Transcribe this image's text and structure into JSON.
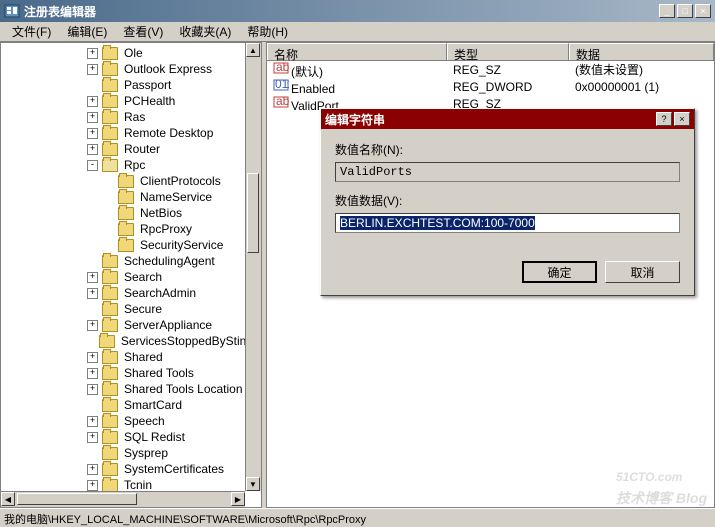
{
  "window": {
    "title": "注册表编辑器",
    "min": "_",
    "max": "□",
    "close": "×"
  },
  "menu": {
    "file": "文件(F)",
    "edit": "编辑(E)",
    "view": "查看(V)",
    "fav": "收藏夹(A)",
    "help": "帮助(H)"
  },
  "tree": {
    "items": [
      {
        "indent": 84,
        "exp": "+",
        "label": "Ole"
      },
      {
        "indent": 84,
        "exp": "+",
        "label": "Outlook Express"
      },
      {
        "indent": 84,
        "exp": "",
        "label": "Passport"
      },
      {
        "indent": 84,
        "exp": "+",
        "label": "PCHealth"
      },
      {
        "indent": 84,
        "exp": "+",
        "label": "Ras"
      },
      {
        "indent": 84,
        "exp": "+",
        "label": "Remote Desktop"
      },
      {
        "indent": 84,
        "exp": "+",
        "label": "Router"
      },
      {
        "indent": 84,
        "exp": "-",
        "label": "Rpc",
        "open": true
      },
      {
        "indent": 100,
        "exp": "",
        "label": "ClientProtocols"
      },
      {
        "indent": 100,
        "exp": "",
        "label": "NameService"
      },
      {
        "indent": 100,
        "exp": "",
        "label": "NetBios"
      },
      {
        "indent": 100,
        "exp": "",
        "label": "RpcProxy"
      },
      {
        "indent": 100,
        "exp": "",
        "label": "SecurityService"
      },
      {
        "indent": 84,
        "exp": "",
        "label": "SchedulingAgent"
      },
      {
        "indent": 84,
        "exp": "+",
        "label": "Search"
      },
      {
        "indent": 84,
        "exp": "+",
        "label": "SearchAdmin"
      },
      {
        "indent": 84,
        "exp": "",
        "label": "Secure"
      },
      {
        "indent": 84,
        "exp": "+",
        "label": "ServerAppliance"
      },
      {
        "indent": 84,
        "exp": "",
        "label": "ServicesStoppedByStingr"
      },
      {
        "indent": 84,
        "exp": "+",
        "label": "Shared"
      },
      {
        "indent": 84,
        "exp": "+",
        "label": "Shared Tools"
      },
      {
        "indent": 84,
        "exp": "+",
        "label": "Shared Tools Location"
      },
      {
        "indent": 84,
        "exp": "",
        "label": "SmartCard"
      },
      {
        "indent": 84,
        "exp": "+",
        "label": "Speech"
      },
      {
        "indent": 84,
        "exp": "+",
        "label": "SQL Redist"
      },
      {
        "indent": 84,
        "exp": "",
        "label": "Sysprep"
      },
      {
        "indent": 84,
        "exp": "+",
        "label": "SystemCertificates"
      },
      {
        "indent": 84,
        "exp": "+",
        "label": "Tcnin"
      }
    ]
  },
  "list": {
    "cols": {
      "name": "名称",
      "type": "类型",
      "data": "数据"
    },
    "rows": [
      {
        "icon": "ab",
        "name": "(默认)",
        "type": "REG_SZ",
        "data": "(数值未设置)"
      },
      {
        "icon": "bin",
        "name": "Enabled",
        "type": "REG_DWORD",
        "data": "0x00000001 (1)"
      },
      {
        "icon": "ab",
        "name": "ValidPort",
        "type": "REG_SZ",
        "data": ""
      }
    ]
  },
  "dialog": {
    "title": "编辑字符串",
    "help": "?",
    "close": "×",
    "name_label": "数值名称(N):",
    "name_value": "ValidPorts",
    "data_label": "数值数据(V):",
    "data_value": "BERLIN.EXCHTEST.COM:100-7000",
    "ok": "确定",
    "cancel": "取消"
  },
  "statusbar": "我的电脑\\HKEY_LOCAL_MACHINE\\SOFTWARE\\Microsoft\\Rpc\\RpcProxy",
  "watermark": {
    "main": "51CTO.com",
    "sub": "技术博客  Blog"
  }
}
